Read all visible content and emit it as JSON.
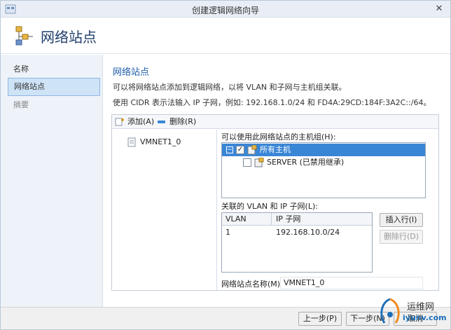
{
  "window": {
    "title": "创建逻辑网络向导"
  },
  "header": {
    "title": "网络站点"
  },
  "sidebar": {
    "items": [
      {
        "label": "名称"
      },
      {
        "label": "网络站点"
      },
      {
        "label": "摘要"
      }
    ]
  },
  "main": {
    "section_title": "网络站点",
    "description_1": "可以将网络站点添加到逻辑网络，以将 VLAN 和子网与主机组关联。",
    "description_2": "使用 CIDR 表示法输入 IP 子网，例如: 192.168.1.0/24 和 FD4A:29CD:184F:3A2C::/64。",
    "toolbar": {
      "add_label": "添加(A)",
      "delete_label": "删除(R)"
    },
    "sites": [
      {
        "label": "VMNET1_0"
      }
    ],
    "host_groups_label": "可以使用此网络站点的主机组(H):",
    "host_groups": [
      {
        "label": "所有主机",
        "checked": true,
        "selected": true
      },
      {
        "label": "SERVER (已禁用继承)",
        "checked": false,
        "selected": false
      }
    ],
    "vlan_label": "关联的 VLAN 和 IP 子网(L):",
    "vlan_table": {
      "columns": [
        "VLAN",
        "IP 子网"
      ],
      "rows": [
        {
          "vlan": "1",
          "subnet": "192.168.10.0/24"
        }
      ]
    },
    "insert_row_label": "插入行(I)",
    "delete_row_label": "删除行(D)",
    "site_name_label": "网络站点名称(M):",
    "site_name_value": "VMNET1_0"
  },
  "footer": {
    "prev_label": "上一步(P)",
    "next_label": "下一步(N)",
    "cancel_label": "取消"
  },
  "watermark": {
    "line1": "运维网",
    "line2": "iyunv.com"
  }
}
